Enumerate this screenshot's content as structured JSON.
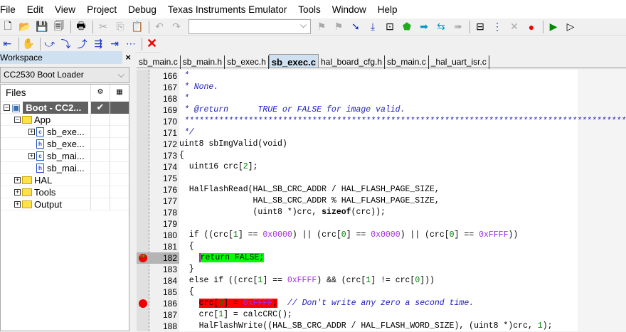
{
  "menu": [
    "File",
    "Edit",
    "View",
    "Project",
    "Debug",
    "Texas Instruments Emulator",
    "Tools",
    "Window",
    "Help"
  ],
  "toolbar1": {
    "search_value": "",
    "icons": [
      "new-file",
      "open",
      "save",
      "save-all",
      "print",
      "cut",
      "copy",
      "paste",
      "undo",
      "redo"
    ],
    "debug_icons": [
      "toggle-bookmark",
      "bookmark-next",
      "go-to-definition",
      "find-in-files",
      "templates",
      "make",
      "compile",
      "download-and-debug",
      "debug-without-download",
      "stop-build",
      "breakpoint",
      "run-to",
      "debug-step"
    ]
  },
  "toolbar2": {
    "icons": [
      "reset",
      "break",
      "step-over",
      "step-into",
      "step-out",
      "next-statement",
      "run-to-cursor",
      "go",
      "stop-debugging"
    ]
  },
  "workspace": {
    "title": "Workspace",
    "close": "×",
    "config": "CC2530 Boot Loader",
    "files_header": "Files",
    "tree": [
      {
        "label": "Boot - CC2...",
        "type": "project",
        "check": "✔",
        "depth": 0,
        "fold": "−"
      },
      {
        "label": "App",
        "type": "folder",
        "depth": 1,
        "fold": "−"
      },
      {
        "label": "sb_exe...",
        "type": "c",
        "depth": 2,
        "fold": "+"
      },
      {
        "label": "sb_exe...",
        "type": "h",
        "depth": 2,
        "fold": ""
      },
      {
        "label": "sb_mai...",
        "type": "c",
        "depth": 2,
        "fold": "+"
      },
      {
        "label": "sb_mai...",
        "type": "h",
        "depth": 2,
        "fold": ""
      },
      {
        "label": "HAL",
        "type": "folder",
        "depth": 1,
        "fold": "+"
      },
      {
        "label": "Tools",
        "type": "folder",
        "depth": 1,
        "fold": "+"
      },
      {
        "label": "Output",
        "type": "folder",
        "depth": 1,
        "fold": "+"
      }
    ]
  },
  "tabs": [
    {
      "label": "sb_main.c"
    },
    {
      "label": "sb_main.h"
    },
    {
      "label": "sb_exec.h"
    },
    {
      "label": "sb_exec.c",
      "active": true
    },
    {
      "label": "hal_board_cfg.h"
    },
    {
      "label": "sb_main.c"
    },
    {
      "label": "_hal_uart_isr.c"
    }
  ],
  "code": [
    {
      "n": "166",
      "s": [
        [
          " *",
          "cm"
        ]
      ]
    },
    {
      "n": "167",
      "s": [
        [
          " * None.",
          "cm"
        ]
      ]
    },
    {
      "n": "168",
      "s": [
        [
          " *",
          "cm"
        ]
      ]
    },
    {
      "n": "169",
      "s": [
        [
          " * @return      TRUE or FALSE for image valid.",
          "cm"
        ]
      ]
    },
    {
      "n": "170",
      "s": [
        [
          " ******************************************************************************************",
          "cm"
        ]
      ]
    },
    {
      "n": "171",
      "s": [
        [
          " */",
          "cm"
        ]
      ]
    },
    {
      "n": "172",
      "s": [
        [
          "uint8 sbImgValid(void)",
          ""
        ]
      ]
    },
    {
      "n": "173",
      "s": [
        [
          "{",
          ""
        ]
      ]
    },
    {
      "n": "174",
      "s": [
        [
          "  uint16 crc[",
          ""
        ],
        [
          "2",
          "idx"
        ],
        [
          "];",
          ""
        ]
      ]
    },
    {
      "n": "175",
      "s": []
    },
    {
      "n": "176",
      "s": [
        [
          "  HalFlashRead(HAL_SB_CRC_ADDR / HAL_FLASH_PAGE_SIZE,",
          ""
        ]
      ]
    },
    {
      "n": "177",
      "s": [
        [
          "               HAL_SB_CRC_ADDR % HAL_FLASH_PAGE_SIZE,",
          ""
        ]
      ]
    },
    {
      "n": "178",
      "s": [
        [
          "               (uint8 *)crc, ",
          ""
        ],
        [
          "sizeof",
          "kw"
        ],
        [
          "(crc));",
          ""
        ]
      ]
    },
    {
      "n": "179",
      "s": []
    },
    {
      "n": "180",
      "s": [
        [
          "  if ((crc[",
          ""
        ],
        [
          "1",
          "idx"
        ],
        [
          "] == ",
          ""
        ],
        [
          "0x0000",
          "num"
        ],
        [
          ") || (crc[",
          ""
        ],
        [
          "0",
          "idx"
        ],
        [
          "] == ",
          ""
        ],
        [
          "0x0000",
          "num"
        ],
        [
          ") || (crc[",
          ""
        ],
        [
          "0",
          "idx"
        ],
        [
          "] == ",
          ""
        ],
        [
          "0xFFFF",
          "num"
        ],
        [
          "))",
          ""
        ]
      ]
    },
    {
      "n": "181",
      "s": [
        [
          "  {",
          ""
        ]
      ]
    },
    {
      "n": "182",
      "s": [
        [
          "    ",
          ""
        ],
        [
          "return FALSE;",
          "hl-g"
        ]
      ],
      "marker": "pc"
    },
    {
      "n": "183",
      "s": [
        [
          "  }",
          ""
        ]
      ]
    },
    {
      "n": "184",
      "s": [
        [
          "  else if ((crc[",
          ""
        ],
        [
          "1",
          "idx"
        ],
        [
          "] == ",
          ""
        ],
        [
          "0xFFFF",
          "num"
        ],
        [
          ") && (crc[",
          ""
        ],
        [
          "1",
          "idx"
        ],
        [
          "] != crc[",
          ""
        ],
        [
          "0",
          "idx"
        ],
        [
          "]))",
          ""
        ]
      ]
    },
    {
      "n": "185",
      "s": [
        [
          "  {",
          ""
        ]
      ]
    },
    {
      "n": "186",
      "s": [
        [
          "    ",
          ""
        ],
        [
          "crc[0] = 0xFFFF;",
          "hl-r"
        ],
        [
          "  ",
          ""
        ],
        [
          "// Don't write any zero a second time.",
          "cm"
        ]
      ],
      "marker": "bp"
    },
    {
      "n": "187",
      "s": [
        [
          "    crc[",
          ""
        ],
        [
          "1",
          "idx"
        ],
        [
          "] = calcCRC();",
          ""
        ]
      ]
    },
    {
      "n": "188",
      "s": [
        [
          "    HalFlashWrite((HAL_SB_CRC_ADDR / HAL_FLASH_WORD_SIZE), (uint8 *)crc, ",
          ""
        ],
        [
          "1",
          "idx"
        ],
        [
          ");",
          ""
        ]
      ]
    }
  ]
}
